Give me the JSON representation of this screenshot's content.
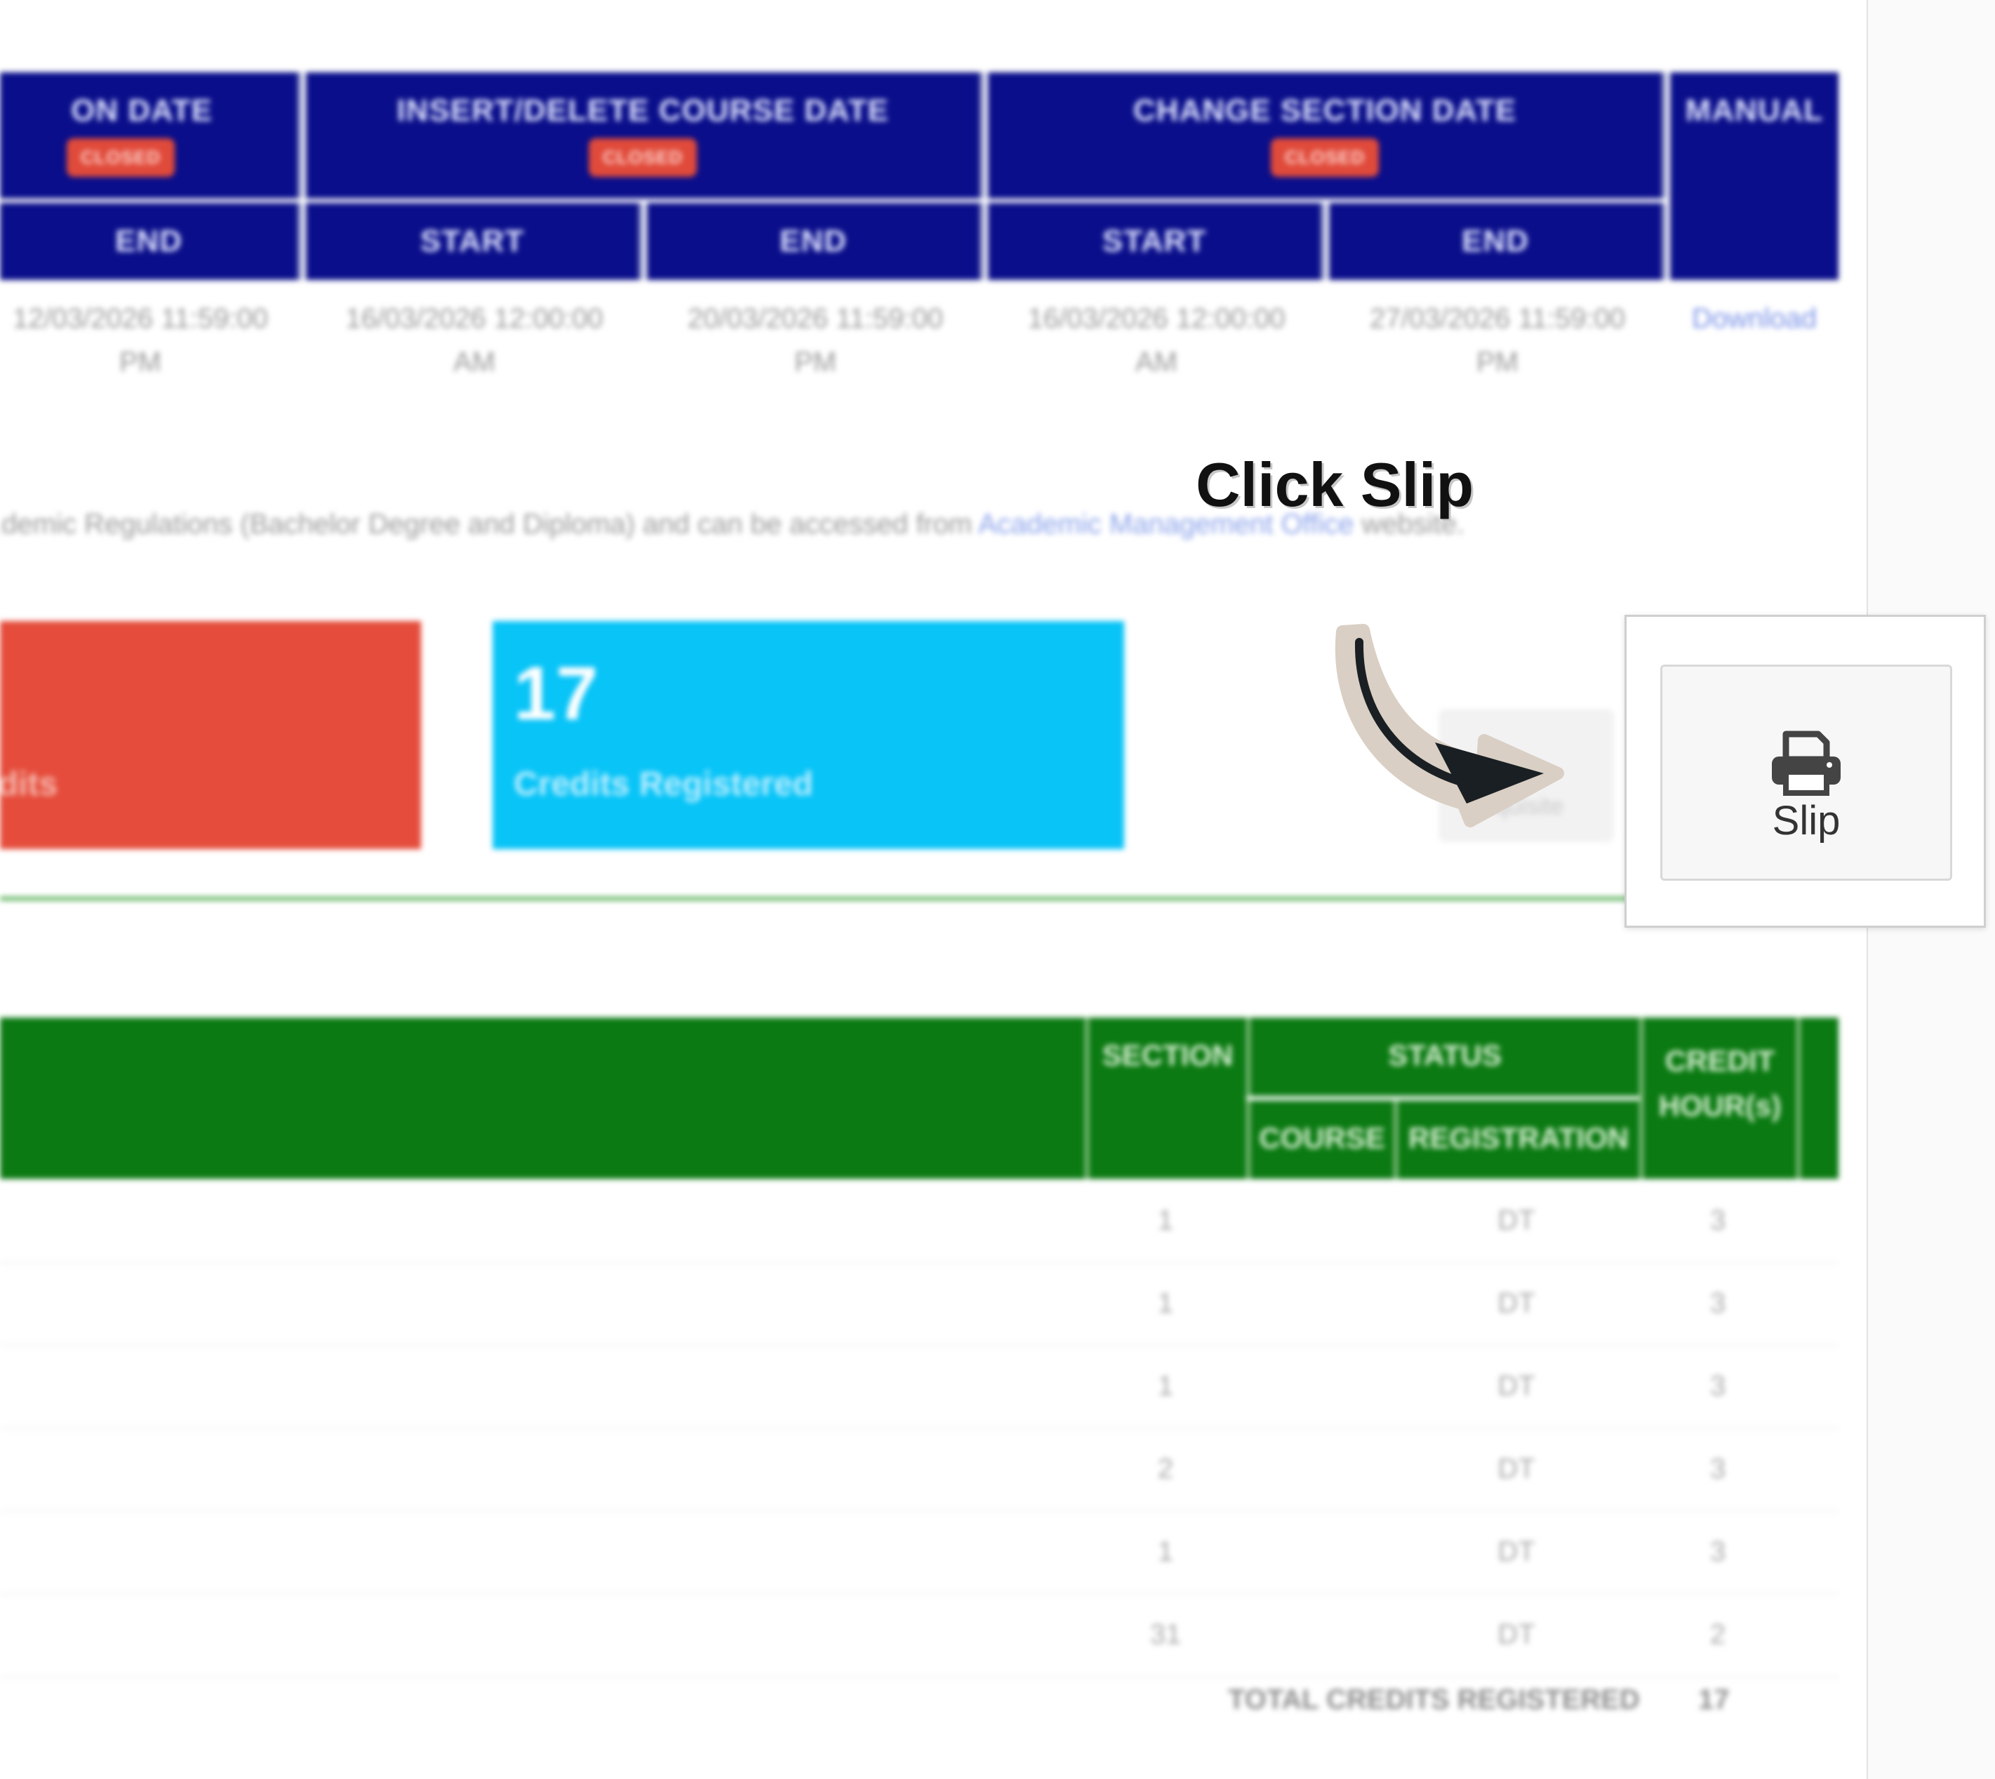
{
  "schedule": {
    "registration_header": "ON DATE",
    "insert_delete_header": "INSERT/DELETE COURSE DATE",
    "change_section_header": "CHANGE SECTION DATE",
    "manual_header": "MANUAL",
    "status_closed": "CLOSED",
    "start_label": "START",
    "end_label": "END",
    "dates": {
      "reg_end": [
        "12/03/2026 11:59:00",
        "PM"
      ],
      "insert_start": [
        "16/03/2026 12:00:00",
        "AM"
      ],
      "insert_end": [
        "20/03/2026 11:59:00",
        "PM"
      ],
      "change_start": [
        "16/03/2026 12:00:00",
        "AM"
      ],
      "change_end": [
        "27/03/2026 11:59:00",
        "PM"
      ]
    },
    "manual_link": "Download"
  },
  "note": {
    "text": "ademic Regulations (Bachelor Degree and Diploma) and can be accessed from",
    "link": "Academic Management Office",
    "suffix": "website."
  },
  "cards": {
    "red_label": "edits",
    "blue_value": "17",
    "blue_label": "Credits Registered"
  },
  "ghost_button_label": "quisite",
  "courses": {
    "headers": {
      "section": "SECTION",
      "status": "STATUS",
      "course": "COURSE",
      "registration": "REGISTRATION",
      "credit": "CREDIT HOUR(s)"
    },
    "rows": [
      {
        "section": "1",
        "registration": "DT",
        "credit": "3"
      },
      {
        "section": "1",
        "registration": "DT",
        "credit": "3"
      },
      {
        "section": "1",
        "registration": "DT",
        "credit": "3"
      },
      {
        "section": "2",
        "registration": "DT",
        "credit": "3"
      },
      {
        "section": "1",
        "registration": "DT",
        "credit": "3"
      },
      {
        "section": "31",
        "registration": "DT",
        "credit": "2"
      }
    ],
    "total_label": "TOTAL CREDITS REGISTERED",
    "total_value": "17"
  },
  "annotation": "Click Slip",
  "slip_button": {
    "label": "Slip",
    "icon": "printer-icon"
  },
  "colors": {
    "schedule_header": "#0a0e8a",
    "course_header": "#0b7a12",
    "closed_badge": "#e04a3a",
    "card_red": "#e54c3b",
    "card_blue": "#08c4f7"
  }
}
